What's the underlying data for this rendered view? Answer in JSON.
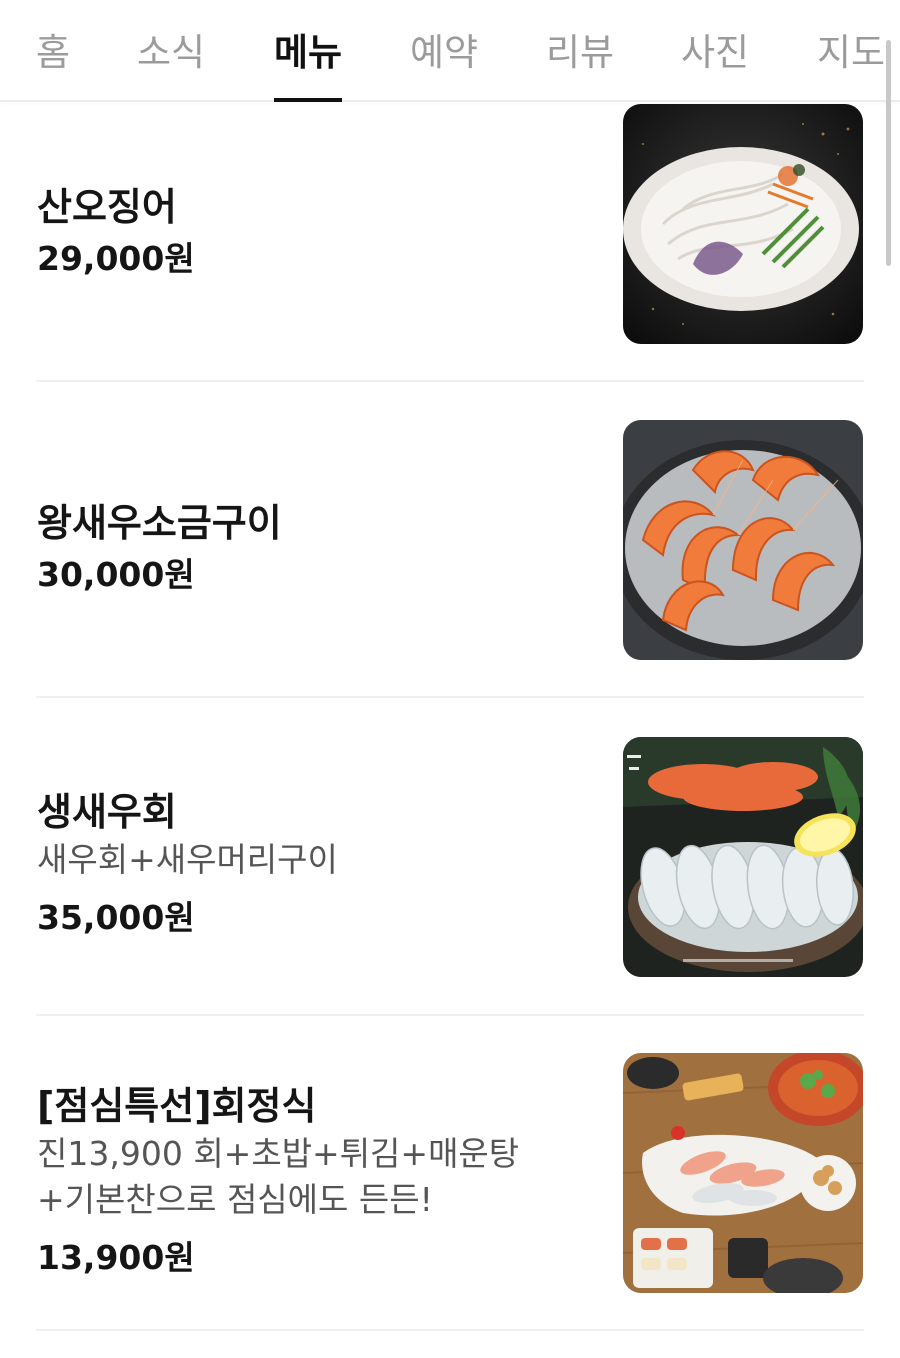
{
  "tabs": [
    {
      "label": "홈",
      "active": false
    },
    {
      "label": "소식",
      "active": false
    },
    {
      "label": "메뉴",
      "active": true
    },
    {
      "label": "예약",
      "active": false
    },
    {
      "label": "리뷰",
      "active": false
    },
    {
      "label": "사진",
      "active": false
    },
    {
      "label": "지도",
      "active": false
    }
  ],
  "menu": {
    "items": [
      {
        "name": "산오징어",
        "description": "",
        "price": "29,000원",
        "image_icon": "squid-dish-photo"
      },
      {
        "name": "왕새우소금구이",
        "description": "",
        "price": "30,000원",
        "image_icon": "salt-grilled-shrimp-photo"
      },
      {
        "name": "생새우회",
        "description": "새우회+새우머리구이",
        "price": "35,000원",
        "image_icon": "raw-shrimp-sashimi-photo"
      },
      {
        "name": "[점심특선]회정식",
        "description": "진13,900 회+초밥+튀김+매운탕+기본찬으로 점심에도 든든!",
        "price": "13,900원",
        "image_icon": "lunch-sashimi-set-photo"
      }
    ]
  },
  "colors": {
    "active_tab": "#111111",
    "inactive_tab": "#9b9b9b",
    "divider": "#f0f0f0"
  }
}
